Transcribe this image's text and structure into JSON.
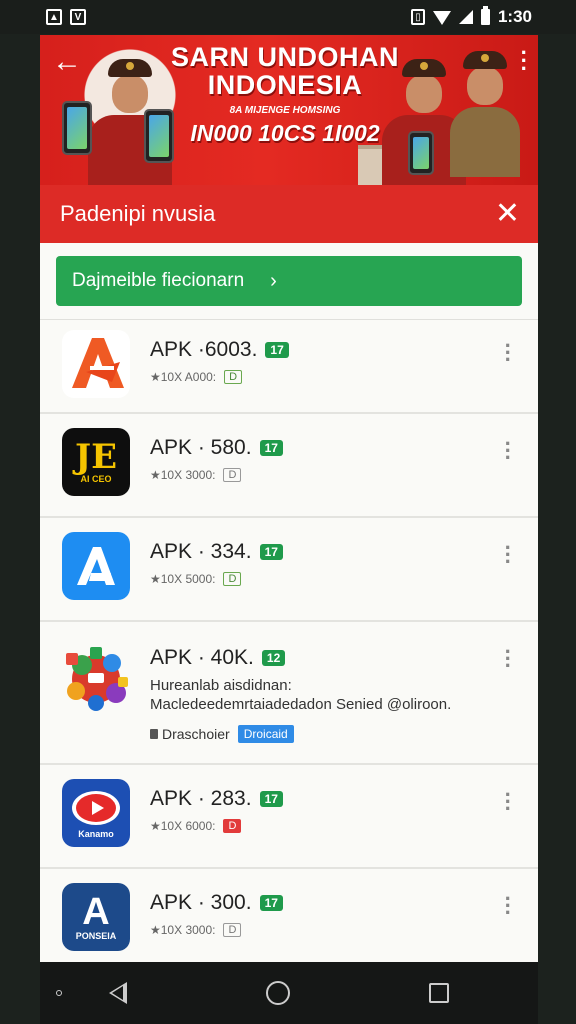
{
  "status_bar": {
    "time": "1:30",
    "left_icons": [
      "image-icon",
      "v-icon"
    ]
  },
  "banner": {
    "title_line1": "SARN UNDOHAN",
    "title_line2": "INDONESIA",
    "subtitle": "8A MIJENGE HOMSING",
    "code": "IN000 10CS 1I002"
  },
  "search": {
    "text": "Padenipi nvusia"
  },
  "primary_button": {
    "label": "Dajmeible fiecionarn",
    "chevron": "›"
  },
  "apps": [
    {
      "title": "APK ·6003.",
      "badge": "17",
      "rating": "★10X A000:",
      "tag": "D",
      "icon_label": "",
      "icon": "orange-a-icon"
    },
    {
      "title": "APK · 580.",
      "badge": "17",
      "rating": "★10X 3000:",
      "tag": "D",
      "icon_label": "AI CEO",
      "icon": "je-logo-icon"
    },
    {
      "title": "APK · 334.",
      "badge": "17",
      "rating": "★10X 5000:",
      "tag": "D",
      "icon_label": "",
      "icon": "blue-a-icon"
    },
    {
      "title": "APK · 40K.",
      "badge": "12",
      "desc1": "Hureanlab aisdidnan:",
      "desc2": "Macledeedemrtaiadedadon Senied @oliroon.",
      "developer": "Draschoier",
      "dev_badge": "Droicaid",
      "icon": "colorful-circles-icon"
    },
    {
      "title": "APK · 283.",
      "badge": "17",
      "rating": "★10X 6000:",
      "tag": "D",
      "icon_label": "Kanamo",
      "icon": "red-play-icon"
    },
    {
      "title": "APK · 300.",
      "badge": "17",
      "rating": "★10X 3000:",
      "tag": "D",
      "icon_label": "PONSEIA",
      "icon": "navy-a-icon"
    }
  ],
  "colors": {
    "banner_red": "#d6201c",
    "search_red": "#dd2b26",
    "button_green": "#27a552"
  }
}
